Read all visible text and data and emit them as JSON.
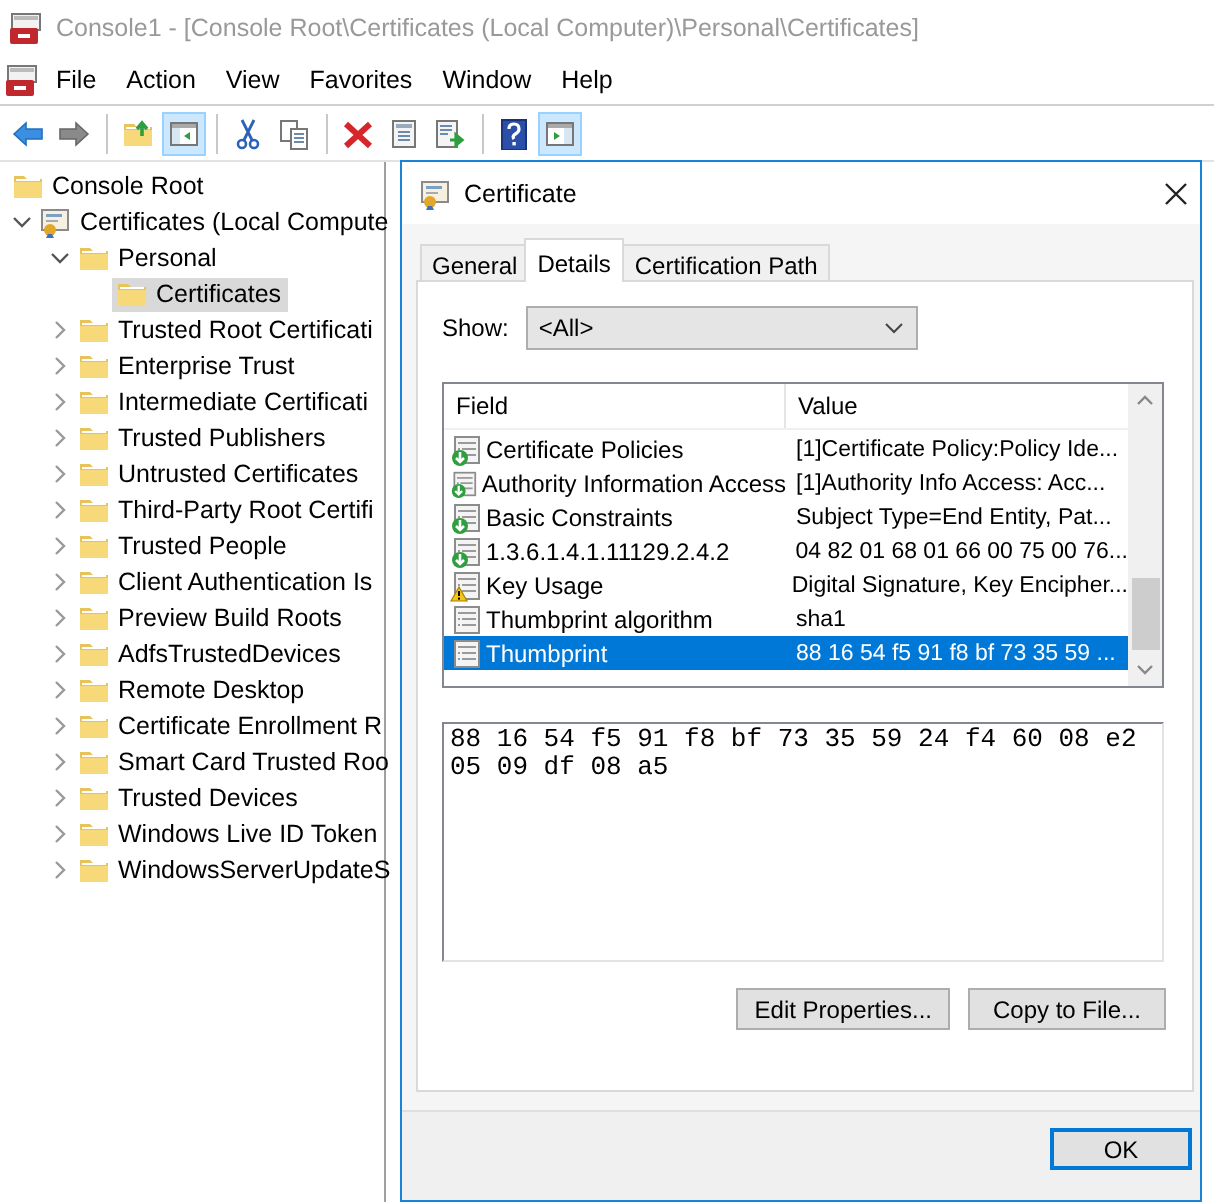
{
  "window": {
    "title": "Console1 - [Console Root\\Certificates (Local Computer)\\Personal\\Certificates]"
  },
  "menu": [
    "File",
    "Action",
    "View",
    "Favorites",
    "Window",
    "Help"
  ],
  "toolbar": [
    {
      "pressed": false
    },
    {
      "pressed": false
    },
    {
      "pressed": false
    },
    {
      "pressed": true
    },
    {
      "pressed": false
    },
    {
      "pressed": false
    },
    {
      "pressed": false
    },
    {
      "pressed": false
    },
    {
      "pressed": false
    },
    {
      "pressed": false
    },
    {
      "pressed": true
    }
  ],
  "tree": [
    {
      "label": "Console Root",
      "kind": "folder",
      "selected": false,
      "children": [
        {
          "label": "Certificates (Local Compute",
          "kind": "snapin",
          "selected": false,
          "expanded": true,
          "children": [
            {
              "label": "Personal",
              "kind": "folder",
              "selected": false,
              "expanded": true,
              "children": [
                {
                  "label": "Certificates",
                  "kind": "folder",
                  "selected": true
                }
              ]
            },
            {
              "label": "Trusted Root Certificati",
              "kind": "folder",
              "selected": false,
              "expanded": false
            },
            {
              "label": "Enterprise Trust",
              "kind": "folder",
              "selected": false,
              "expanded": false
            },
            {
              "label": "Intermediate Certificati",
              "kind": "folder",
              "selected": false,
              "expanded": false
            },
            {
              "label": "Trusted Publishers",
              "kind": "folder",
              "selected": false,
              "expanded": false
            },
            {
              "label": "Untrusted Certificates",
              "kind": "folder",
              "selected": false,
              "expanded": false
            },
            {
              "label": "Third-Party Root Certifi",
              "kind": "folder",
              "selected": false,
              "expanded": false
            },
            {
              "label": "Trusted People",
              "kind": "folder",
              "selected": false,
              "expanded": false
            },
            {
              "label": "Client Authentication Is",
              "kind": "folder",
              "selected": false,
              "expanded": false
            },
            {
              "label": "Preview Build Roots",
              "kind": "folder",
              "selected": false,
              "expanded": false
            },
            {
              "label": "AdfsTrustedDevices",
              "kind": "folder",
              "selected": false,
              "expanded": false
            },
            {
              "label": "Remote Desktop",
              "kind": "folder",
              "selected": false,
              "expanded": false
            },
            {
              "label": "Certificate Enrollment R",
              "kind": "folder",
              "selected": false,
              "expanded": false
            },
            {
              "label": "Smart Card Trusted Roo",
              "kind": "folder",
              "selected": false,
              "expanded": false
            },
            {
              "label": "Trusted Devices",
              "kind": "folder",
              "selected": false,
              "expanded": false
            },
            {
              "label": "Windows Live ID Token",
              "kind": "folder",
              "selected": false,
              "expanded": false
            },
            {
              "label": "WindowsServerUpdateS",
              "kind": "folder",
              "selected": false,
              "expanded": false
            }
          ]
        }
      ]
    }
  ],
  "dialog": {
    "title": "Certificate",
    "tabs": [
      {
        "label": "General",
        "selected": false
      },
      {
        "label": "Details",
        "selected": true
      },
      {
        "label": "Certification Path",
        "selected": false
      }
    ],
    "show_label": "Show:",
    "show_value": "<All>",
    "columns": [
      "Field",
      "Value"
    ],
    "fields": [
      {
        "kind": "extension",
        "field": "Certificate Policies",
        "value": "[1]Certificate Policy:Policy Ide...",
        "selected": false
      },
      {
        "kind": "extension",
        "field": "Authority Information Access",
        "value": "[1]Authority Info Access: Acc...",
        "selected": false
      },
      {
        "kind": "extension",
        "field": "Basic Constraints",
        "value": "Subject Type=End Entity, Pat...",
        "selected": false
      },
      {
        "kind": "extension",
        "field": "1.3.6.1.4.1.11129.2.4.2",
        "value": "04 82 01 68 01 66 00 75 00 76...",
        "selected": false
      },
      {
        "kind": "warning",
        "field": "Key Usage",
        "value": "Digital Signature, Key Encipher...",
        "selected": false
      },
      {
        "kind": "property",
        "field": "Thumbprint algorithm",
        "value": "sha1",
        "selected": false
      },
      {
        "kind": "property",
        "field": "Thumbprint",
        "value": "88 16 54 f5 91 f8 bf 73 35 59 ...",
        "selected": true
      }
    ],
    "value_text": "88 16 54 f5 91 f8 bf 73 35 59 24 f4 60 08 e2 05 09 df 08 a5",
    "buttons": [
      "Edit Properties...",
      "Copy to File..."
    ],
    "ok": "OK"
  }
}
